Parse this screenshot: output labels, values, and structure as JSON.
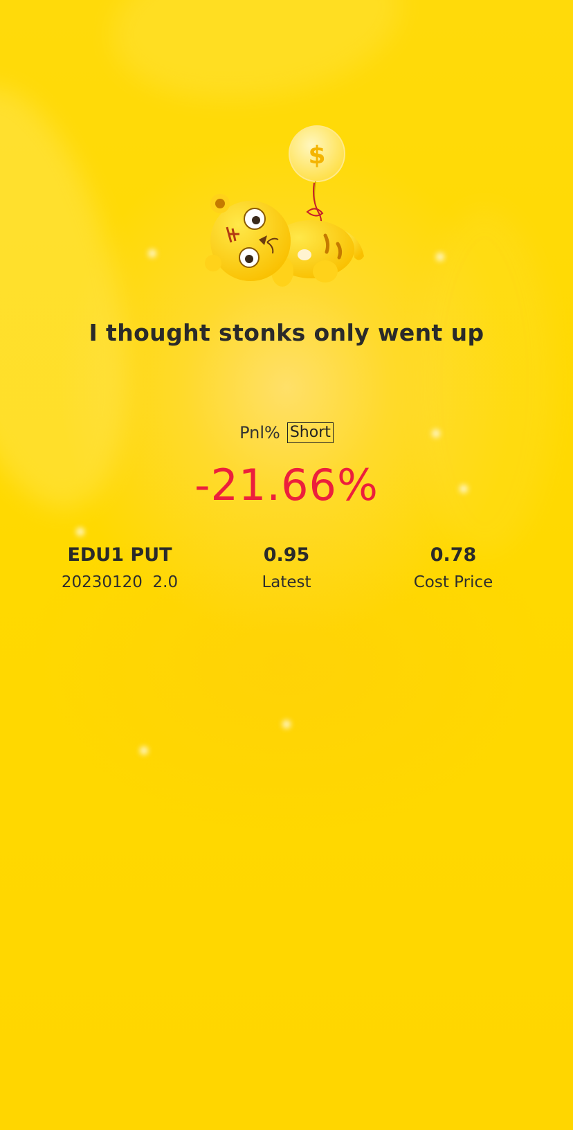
{
  "headline": "I thought stonks only went up",
  "pnl": {
    "label": "Pnl%",
    "side": "Short",
    "value": "-21.66%"
  },
  "stats": [
    {
      "main": "EDU1 PUT",
      "sub": "20230120  2.0"
    },
    {
      "main": "0.95",
      "sub": "Latest"
    },
    {
      "main": "0.78",
      "sub": "Cost Price"
    }
  ],
  "colors": {
    "background": "#FFD900",
    "loss": "#EC1F3C",
    "text": "#2A2A2A"
  },
  "icons": {
    "mascot": "tiger-with-dollar-balloon"
  }
}
